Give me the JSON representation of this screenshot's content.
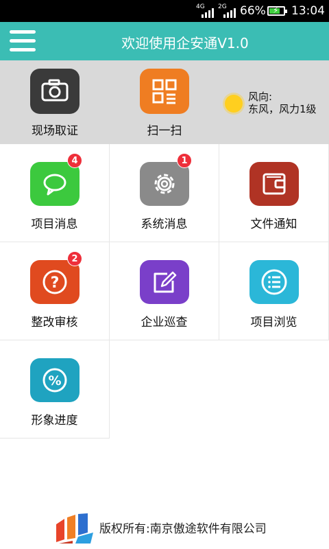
{
  "status_bar": {
    "network_1": "4G",
    "network_2": "2G",
    "battery_percent": "66%",
    "time": "13:04",
    "battery_level": 0.66
  },
  "header": {
    "title": "欢迎使用企安通V1.0",
    "menu_icon": "hamburger-menu-icon",
    "color": "#3bbdb4"
  },
  "quick_actions": [
    {
      "label": "现场取证",
      "icon": "camera-icon",
      "color": "#3b3b3b"
    },
    {
      "label": "扫一扫",
      "icon": "qr-scan-icon",
      "color": "#ef7d22"
    }
  ],
  "weather": {
    "icon": "sun-icon",
    "line1": "风向:",
    "line2": "东风，风力1级"
  },
  "modules": [
    {
      "label": "项目消息",
      "icon": "chat-bubble-icon",
      "color": "#3cc93e",
      "badge": "4"
    },
    {
      "label": "系统消息",
      "icon": "gear-icon",
      "color": "#8a8a8a",
      "badge": "1"
    },
    {
      "label": "文件通知",
      "icon": "wallet-icon",
      "color": "#b03324",
      "badge": ""
    },
    {
      "label": "整改审核",
      "icon": "question-icon",
      "color": "#e04a1f",
      "badge": "2"
    },
    {
      "label": "企业巡查",
      "icon": "pen-edit-icon",
      "color": "#7a3fc9",
      "badge": ""
    },
    {
      "label": "项目浏览",
      "icon": "list-icon",
      "color": "#2bb7d8",
      "badge": ""
    },
    {
      "label": "形象进度",
      "icon": "percent-icon",
      "color": "#1fa3c0",
      "badge": ""
    }
  ],
  "footer": {
    "text": "版权所有:南京傲途软件有限公司",
    "logo": "company-logo-icon"
  }
}
